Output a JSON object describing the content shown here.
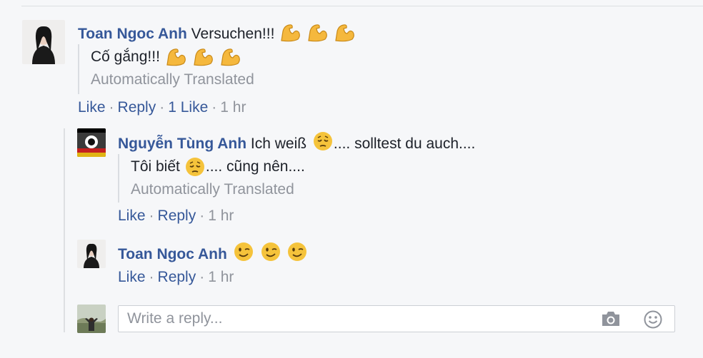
{
  "comments": [
    {
      "author": "Toan Ngoc Anh",
      "message": "Versuchen!!!",
      "message_emojis": [
        "flexed-biceps",
        "flexed-biceps",
        "flexed-biceps"
      ],
      "translation": "Cố gắng!!!",
      "translation_emojis": [
        "flexed-biceps",
        "flexed-biceps",
        "flexed-biceps"
      ],
      "translated_label": "Automatically Translated",
      "actions": {
        "like": "Like",
        "reply": "Reply",
        "likes_count": "1 Like",
        "time": "1 hr"
      }
    }
  ],
  "replies": [
    {
      "author": "Nguyễn Tùng Anh",
      "message_before": "Ich weiß",
      "message_emoji": "pensive-face",
      "message_after": ".... solltest du auch....",
      "translation_before": "Tôi biết",
      "translation_emoji": "pensive-face",
      "translation_after": ".... cũng nên....",
      "translated_label": "Automatically Translated",
      "actions": {
        "like": "Like",
        "reply": "Reply",
        "time": "1 hr"
      }
    },
    {
      "author": "Toan Ngoc Anh",
      "message_emojis": [
        "winking-face",
        "winking-face",
        "winking-face"
      ],
      "actions": {
        "like": "Like",
        "reply": "Reply",
        "time": "1 hr"
      }
    }
  ],
  "reply_box": {
    "placeholder": "Write a reply...",
    "icons": [
      "camera-icon",
      "emoji-icon"
    ]
  },
  "colors": {
    "link": "#365899",
    "meta": "#90949c",
    "text": "#1d2129",
    "background": "#f6f7f9",
    "emoji": "#f5b83d"
  }
}
